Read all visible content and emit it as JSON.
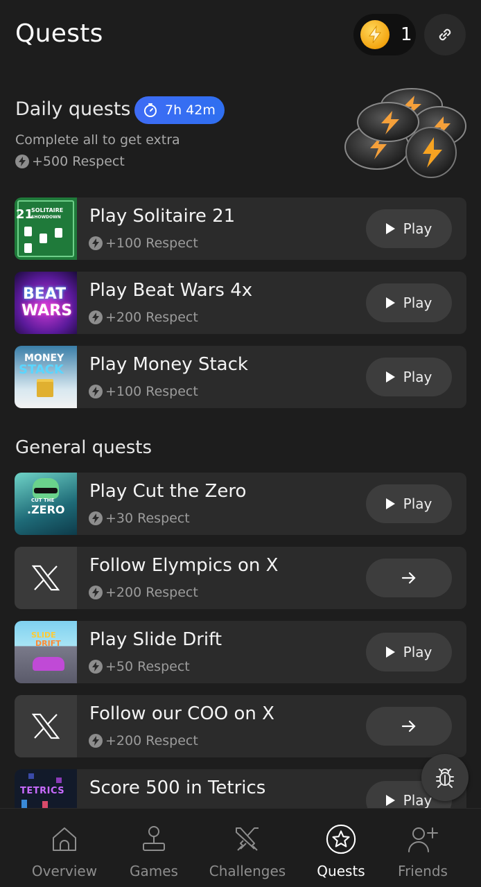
{
  "header": {
    "title": "Quests",
    "coin_count": "1"
  },
  "daily": {
    "title": "Daily quests",
    "timer": "7h 42m",
    "subtitle": "Complete all to get extra",
    "bonus": "+500 Respect"
  },
  "daily_quests": [
    {
      "title": "Play Solitaire 21",
      "reward": "+100 Respect",
      "action": "Play",
      "thumb_text": [
        "21",
        "SOLITAIRE",
        "SHOWDOWN"
      ]
    },
    {
      "title": "Play Beat Wars 4x",
      "reward": "+200 Respect",
      "action": "Play",
      "thumb_text": [
        "BEAT",
        "WARS"
      ]
    },
    {
      "title": "Play Money Stack",
      "reward": "+100 Respect",
      "action": "Play",
      "thumb_text": [
        "MONEY",
        "STACK"
      ]
    }
  ],
  "general": {
    "title": "General quests"
  },
  "general_quests": [
    {
      "title": "Play Cut the Zero",
      "reward": "+30 Respect",
      "action": "Play",
      "thumb_text": [
        "CUT THE",
        ".ZERO"
      ]
    },
    {
      "title": "Follow Elympics on X",
      "reward": "+200 Respect",
      "action": ""
    },
    {
      "title": "Play Slide Drift",
      "reward": "+50 Respect",
      "action": "Play",
      "thumb_text": [
        "SLIDE",
        "DRIFT"
      ]
    },
    {
      "title": "Follow our COO on X",
      "reward": "+200 Respect",
      "action": ""
    },
    {
      "title": "Score 500 in Tetrics",
      "reward": "",
      "action": "Play",
      "thumb_text": [
        "TETRICS"
      ]
    }
  ],
  "nav": [
    {
      "label": "Overview",
      "icon": "home-icon"
    },
    {
      "label": "Games",
      "icon": "joystick-icon"
    },
    {
      "label": "Challenges",
      "icon": "crossed-swords-icon"
    },
    {
      "label": "Quests",
      "icon": "star-badge-icon",
      "active": true
    },
    {
      "label": "Friends",
      "icon": "add-friend-icon"
    }
  ],
  "colors": {
    "background": "#1d1d1d",
    "card": "#2b2b2b",
    "accent": "#3e6cf5",
    "coin": "#f3a511"
  }
}
